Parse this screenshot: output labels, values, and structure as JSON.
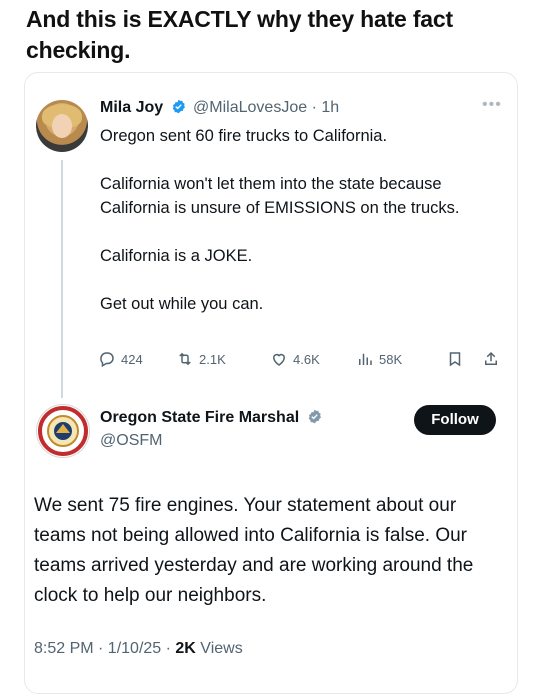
{
  "caption": "And this is EXACTLY why they hate fact checking.",
  "tweet": {
    "author_name": "Mila Joy",
    "handle": "@MilaLovesJoe",
    "time": "1h",
    "text": [
      "Oregon sent 60 fire trucks to California.",
      "California won't let them into the state because California is unsure of EMISSIONS on the trucks.",
      "California is a JOKE.",
      "Get out while you can."
    ],
    "stats": {
      "replies": "424",
      "reposts": "2.1K",
      "likes": "4.6K",
      "views": "58K"
    }
  },
  "reply": {
    "author_name": "Oregon State Fire Marshal",
    "handle": "@OSFM",
    "follow_label": "Follow",
    "text": "We sent 75 fire engines. Your statement about our teams not being allowed into California is false. Our teams arrived yesterday and are working around the clock to help our neighbors.",
    "timestamp": "8:52 PM · 1/10/25 · ",
    "views_count": "2K",
    "views_label": " Views"
  },
  "colors": {
    "verified_blue": "#1d9bf0",
    "verified_gray": "#829aab",
    "text": "#0f1419",
    "muted": "#536471"
  },
  "icons": [
    "reply-icon",
    "repost-icon",
    "like-icon",
    "views-icon",
    "bookmark-icon",
    "share-icon",
    "verified-badge-icon",
    "more-icon"
  ]
}
